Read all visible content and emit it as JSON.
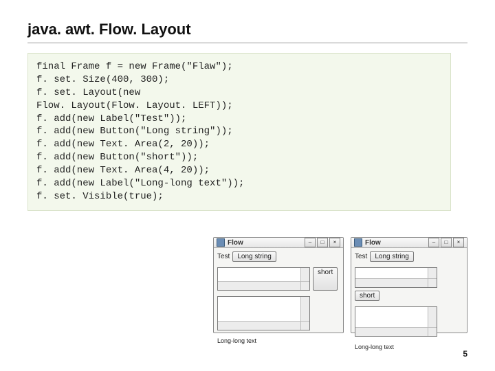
{
  "title": "java. awt. Flow. Layout",
  "code": "final Frame f = new Frame(\"Flaw\");\nf. set. Size(400, 300);\nf. set. Layout(new\nFlow. Layout(Flow. Layout. LEFT));\nf. add(new Label(\"Test\"));\nf. add(new Button(\"Long string\"));\nf. add(new Text. Area(2, 20));\nf. add(new Button(\"short\"));\nf. add(new Text. Area(4, 20));\nf. add(new Label(\"Long-long text\"));\nf. set. Visible(true);",
  "window1": {
    "title": "Flow",
    "label1": "Test",
    "button1": "Long string",
    "button2": "short",
    "label2": "Long-long text"
  },
  "window2": {
    "title": "Flow",
    "label1": "Test",
    "button1": "Long string",
    "button2": "short",
    "label2": "Long-long text"
  },
  "page_number": "5"
}
